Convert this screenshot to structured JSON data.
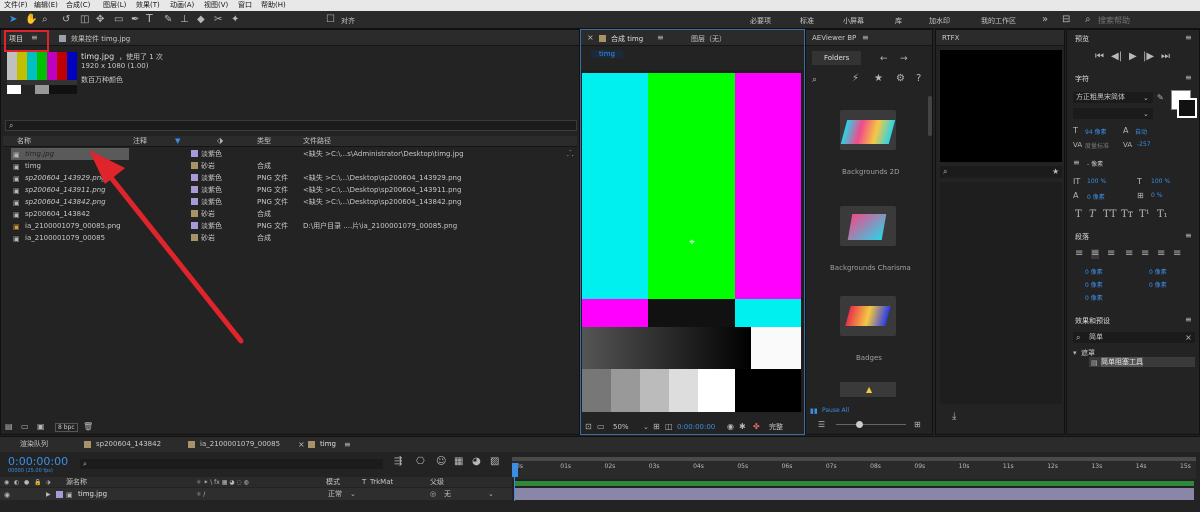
{
  "menu": [
    "文件(F)",
    "编辑(E)",
    "合成(C)",
    "图层(L)",
    "效果(T)",
    "动画(A)",
    "视图(V)",
    "窗口",
    "帮助(H)"
  ],
  "toolbar": {
    "align_label": "对齐",
    "workspaces": [
      "必要项",
      "标准",
      "小屏幕",
      "库",
      "加水印",
      "我的工作区"
    ],
    "search_placeholder": "搜索帮助"
  },
  "project": {
    "tab_label": "项目",
    "effects_tab_label": "效果控件 timg.jpg",
    "item_name": "timg.jpg",
    "used_info": "，使用了 1 次",
    "dimensions": "1920 x 1080 (1.00)",
    "color_depth": "数百万种颜色",
    "columns": {
      "name": "名称",
      "comment": "注释",
      "type": "类型",
      "path": "文件路径"
    },
    "rows": [
      {
        "name": "timg.jpg",
        "label": "淡紫色",
        "type": "",
        "path": "<缺失 >C:\\...s\\Administrator\\Desktop\\timg.jpg",
        "color": "#a89ad6"
      },
      {
        "name": "timg",
        "label": "砂岩",
        "type": "合成",
        "path": "",
        "color": "#a8926a"
      },
      {
        "name": "sp200604_143929.png",
        "label": "淡紫色",
        "type": "PNG 文件",
        "path": "<缺失 >C:\\...\\Desktop\\sp200604_143929.png",
        "color": "#a89ad6"
      },
      {
        "name": "sp200604_143911.png",
        "label": "淡紫色",
        "type": "PNG 文件",
        "path": "<缺失 >C:\\...\\Desktop\\sp200604_143911.png",
        "color": "#a89ad6"
      },
      {
        "name": "sp200604_143842.png",
        "label": "淡紫色",
        "type": "PNG 文件",
        "path": "<缺失 >C:\\...\\Desktop\\sp200604_143842.png",
        "color": "#a89ad6"
      },
      {
        "name": "sp200604_143842",
        "label": "砂岩",
        "type": "合成",
        "path": "",
        "color": "#a8926a"
      },
      {
        "name": "ia_2100001079_00085.png",
        "label": "淡紫色",
        "type": "PNG 文件",
        "path": "D:\\用户目录 ....片\\ia_2100001079_00085.png",
        "color": "#a89ad6"
      },
      {
        "name": "ia_2100001079_00085",
        "label": "砂岩",
        "type": "合成",
        "path": "",
        "color": "#a8926a"
      }
    ],
    "bpc": "8 bpc"
  },
  "composition": {
    "tab_label": "合成 timg",
    "layer_tab_label": "图层（无）",
    "sub_tab": "timg",
    "zoom": "50%",
    "timecode": "0:00:00:00",
    "quality": "完整"
  },
  "aeviewer": {
    "title": "AEViewer BP",
    "folders_label": "Folders",
    "items": [
      "Backgrounds 2D",
      "Backgrounds Charisma",
      "Badges"
    ],
    "pause_label": "Pause All"
  },
  "rtfx": {
    "title": "RTFX"
  },
  "right": {
    "preview_title": "预览",
    "char_title": "字符",
    "font_name": "方正粗黑宋简体",
    "font_size": "94 像素",
    "leading": "自动",
    "kerning_label": "度量标准",
    "tracking": "-257",
    "stroke_width": "- 像素",
    "vscale": "100 %",
    "hscale": "100 %",
    "baseline": "0 像素",
    "tsume": "0 %",
    "para_title": "段落",
    "para_values": [
      "0 像素",
      "0 像素",
      "0 像素",
      "0 像素",
      "0 像素"
    ],
    "effects_title": "效果和预设",
    "effects_search": "简单",
    "effects_group": "遮罩",
    "effects_item": "简单阻塞工具"
  },
  "timeline": {
    "tabs": [
      "渲染队列",
      "sp200604_143842",
      "ia_2100001079_00085",
      "timg"
    ],
    "timecode": "0:00:00:00",
    "fps": "00000 (25.00 fps)",
    "columns": {
      "source": "源名称",
      "mode": "模式",
      "trkmat": "TrkMat",
      "parent": "父级"
    },
    "layer": {
      "name": "timg.jpg",
      "mode": "正常",
      "parent": "无"
    },
    "ruler": [
      "0s",
      "01s",
      "02s",
      "03s",
      "04s",
      "05s",
      "06s",
      "07s",
      "08s",
      "09s",
      "10s",
      "11s",
      "12s",
      "13s",
      "14s",
      "15s"
    ]
  },
  "colors": {
    "accent": "#3a8ee6",
    "annotation": "#e0242b",
    "bar_cyan": "#00f0f0",
    "bar_green": "#00ff00",
    "bar_magenta": "#ff00ff"
  }
}
